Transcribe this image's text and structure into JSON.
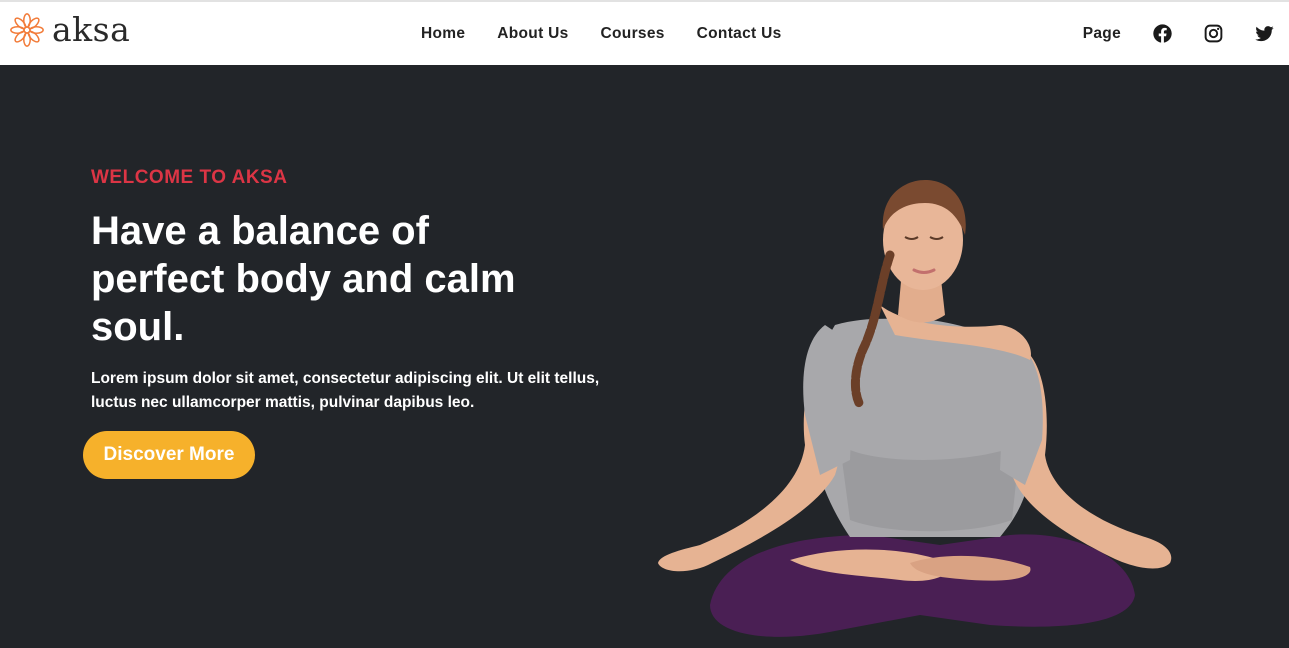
{
  "brand": {
    "name": "aksa",
    "logo_icon": "flower-mandala-icon",
    "logo_color": "#f27c3a"
  },
  "nav": {
    "links": [
      "Home",
      "About Us",
      "Courses",
      "Contact Us"
    ],
    "page_label": "Page",
    "social_icons": [
      "facebook-icon",
      "instagram-icon",
      "twitter-icon"
    ]
  },
  "hero": {
    "eyebrow": "WELCOME TO AKSA",
    "headline": "Have a balance of perfect body and calm soul.",
    "lead": "Lorem ipsum dolor sit amet, consectetur adipiscing elit. Ut elit tellus, luctus nec ullamcorper mattis, pulvinar dapibus leo.",
    "cta_label": "Discover More",
    "image_icon": "meditating-woman-illustration"
  },
  "colors": {
    "hero_bg": "#222529",
    "accent_red": "#dc3545",
    "cta_yellow": "#f6b12b",
    "nav_text": "#222222"
  }
}
